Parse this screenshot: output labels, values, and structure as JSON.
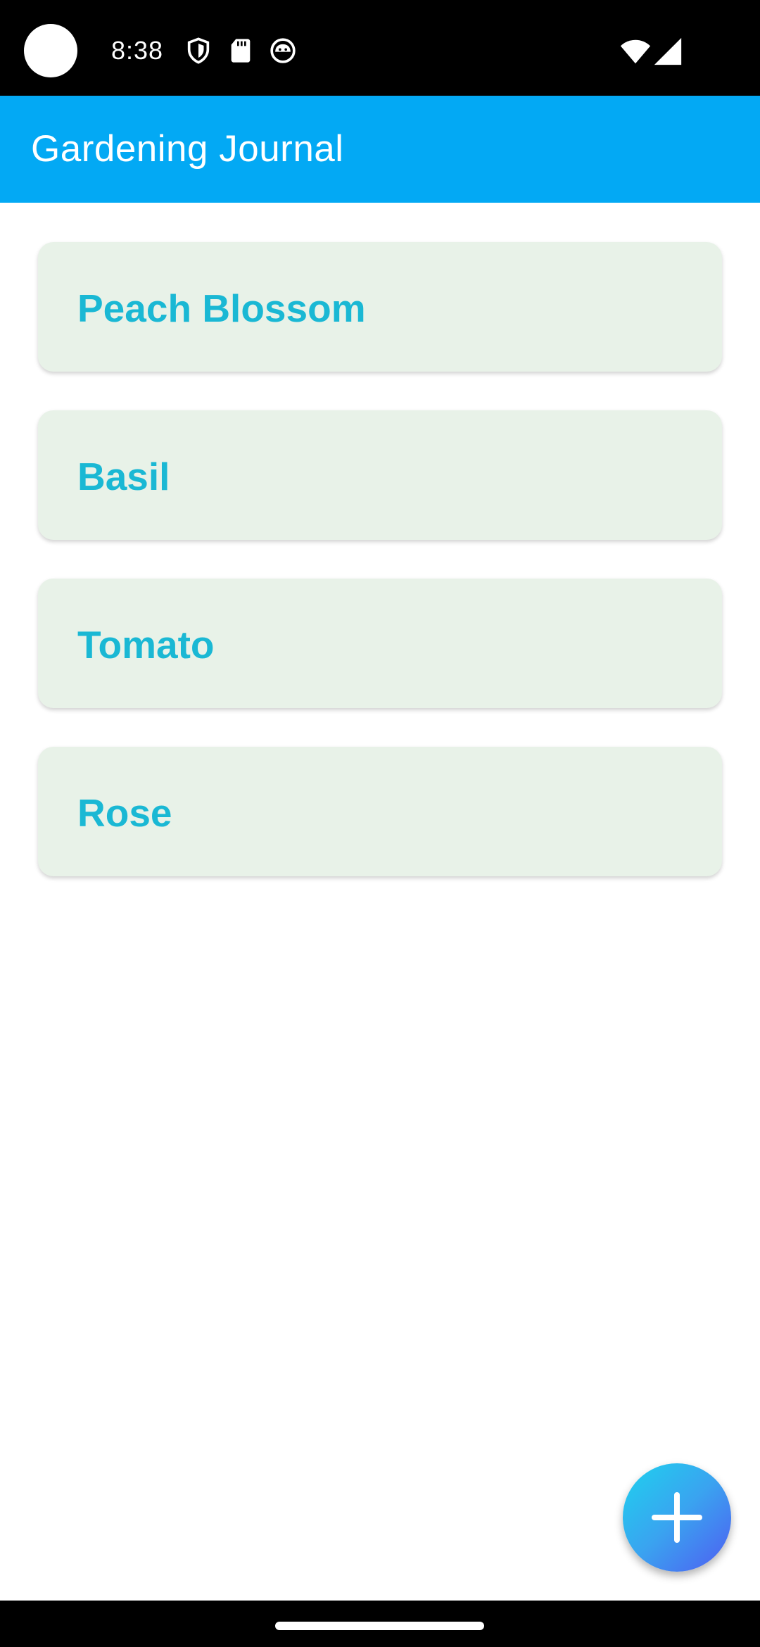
{
  "status_bar": {
    "time": "8:38",
    "icons": [
      "shield-icon",
      "sd-card-icon",
      "face-icon",
      "wifi-icon",
      "signal-icon"
    ]
  },
  "app_bar": {
    "title": "Gardening Journal",
    "color": "#03A9F4"
  },
  "plants": [
    {
      "name": "Peach Blossom"
    },
    {
      "name": "Basil"
    },
    {
      "name": "Tomato"
    },
    {
      "name": "Rose"
    }
  ],
  "fab": {
    "icon": "plus-icon"
  },
  "colors": {
    "card_bg": "#E8F2E8",
    "plant_name": "#1AB8D4"
  }
}
